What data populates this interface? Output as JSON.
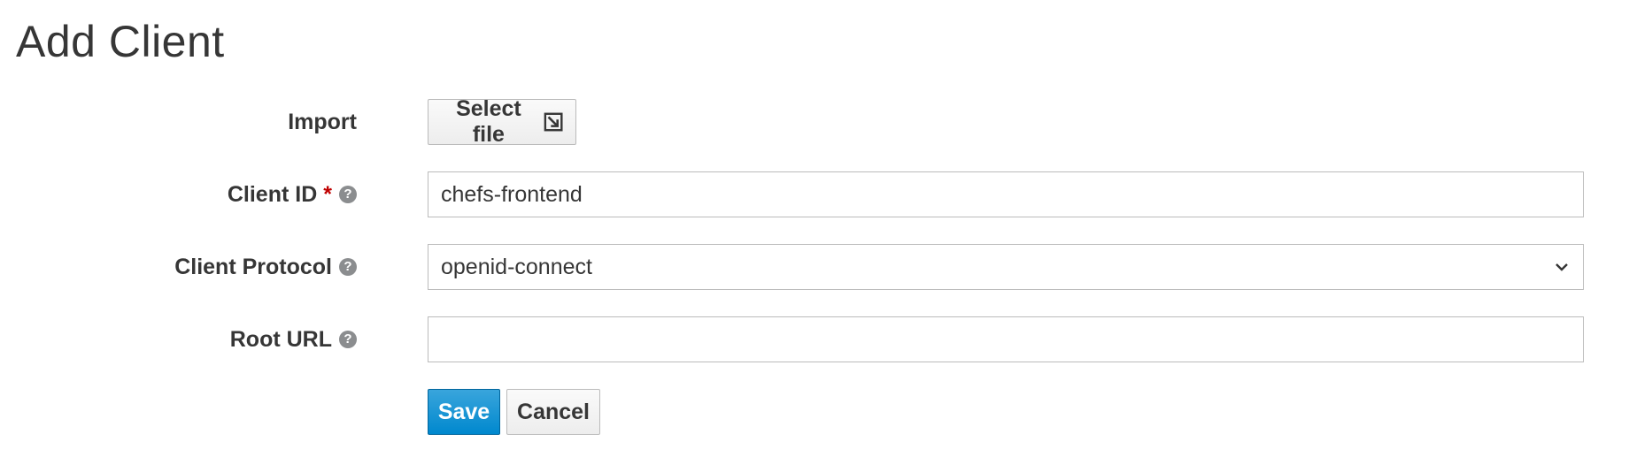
{
  "page": {
    "title": "Add Client"
  },
  "form": {
    "import": {
      "label": "Import",
      "button_label": "Select file",
      "button_icon": "import-file-icon"
    },
    "client_id": {
      "label": "Client ID",
      "required_marker": "*",
      "help_icon": "question-circle-icon",
      "value": "chefs-frontend"
    },
    "client_protocol": {
      "label": "Client Protocol",
      "help_icon": "question-circle-icon",
      "selected": "openid-connect",
      "dropdown_icon": "chevron-down-icon"
    },
    "root_url": {
      "label": "Root URL",
      "help_icon": "question-circle-icon",
      "value": ""
    }
  },
  "actions": {
    "save_label": "Save",
    "cancel_label": "Cancel"
  },
  "colors": {
    "primary": "#0088ce",
    "required": "#c00000",
    "text": "#363636",
    "help_icon": "#8b8d8f"
  }
}
